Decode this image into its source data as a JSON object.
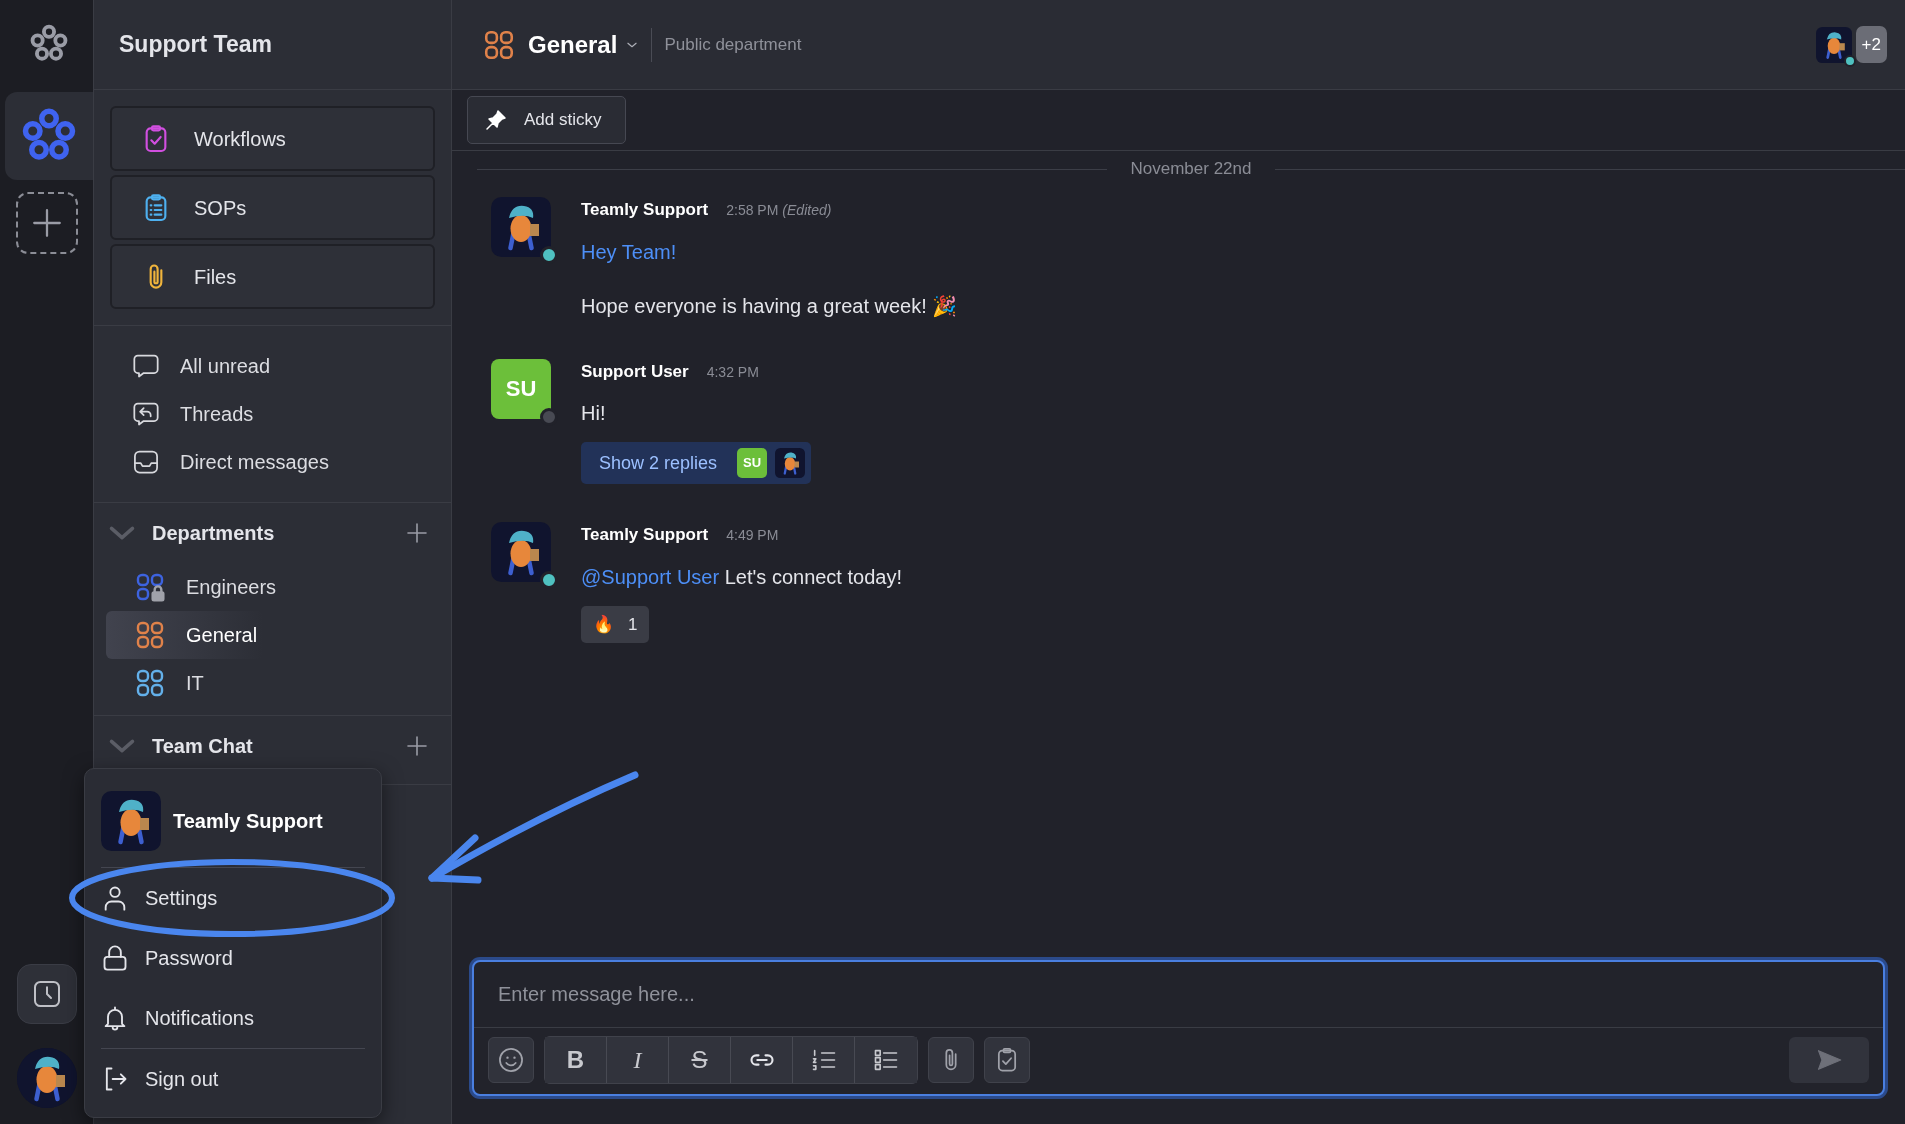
{
  "rail": {
    "workspaces": [
      {
        "selected": false
      },
      {
        "selected": true
      }
    ]
  },
  "sidebar": {
    "title": "Support Team",
    "tools": [
      {
        "label": "Workflows",
        "kind": "workflows"
      },
      {
        "label": "SOPs",
        "kind": "sops"
      },
      {
        "label": "Files",
        "kind": "files"
      }
    ],
    "views": [
      {
        "label": "All unread",
        "kind": "unread"
      },
      {
        "label": "Threads",
        "kind": "threads"
      },
      {
        "label": "Direct messages",
        "kind": "direct"
      }
    ],
    "sections": [
      {
        "title": "Departments",
        "expanded": true,
        "items": [
          {
            "label": "Engineers",
            "color": "#3d63e0",
            "locked": true,
            "selected": false
          },
          {
            "label": "General",
            "color": "#e0824a",
            "locked": false,
            "selected": true
          },
          {
            "label": "IT",
            "color": "#63b0ea",
            "locked": false,
            "selected": false
          }
        ]
      },
      {
        "title": "Team Chat",
        "expanded": true
      }
    ]
  },
  "channel_header": {
    "name": "General",
    "color": "#e0824a",
    "description": "Public department",
    "online": true,
    "extra_members": "+2"
  },
  "toolbar": {
    "add_sticky": "Add sticky"
  },
  "date_divider": "November 22nd",
  "messages": [
    {
      "author": "Teamly Support",
      "kind": "mascot",
      "online": true,
      "time": "2:58 PM",
      "edited": "(Edited)",
      "paragraphs": [
        {
          "spans": [
            {
              "kind": "link",
              "text": "Hey Team!"
            }
          ]
        },
        {
          "spans": [
            {
              "kind": "plain",
              "text": "Hope everyone is having a great week! 🎉"
            }
          ]
        }
      ]
    },
    {
      "author": "Support User",
      "kind": "initials",
      "initials": "SU",
      "online": false,
      "time": "4:32 PM",
      "paragraphs": [
        {
          "spans": [
            {
              "kind": "plain",
              "text": "Hi!"
            }
          ]
        }
      ],
      "replies": {
        "label": "Show 2 replies",
        "avatars": [
          {
            "kind": "initials",
            "initials": "SU"
          },
          {
            "kind": "mascot"
          }
        ]
      }
    },
    {
      "author": "Teamly Support",
      "kind": "mascot",
      "online": true,
      "time": "4:49 PM",
      "paragraphs": [
        {
          "spans": [
            {
              "kind": "mention",
              "text": "@Support User"
            },
            {
              "kind": "plain",
              "text": "Let's connect today!"
            }
          ]
        }
      ],
      "reactions": [
        {
          "emoji": "🔥",
          "count": "1"
        }
      ]
    }
  ],
  "composer": {
    "placeholder": "Enter message here...",
    "format_buttons": [
      {
        "kind": "bold",
        "glyph": "B"
      },
      {
        "kind": "italic",
        "glyph": "I"
      },
      {
        "kind": "strike",
        "glyph": "S"
      },
      {
        "kind": "link"
      },
      {
        "kind": "ordered"
      },
      {
        "kind": "bullets"
      }
    ]
  },
  "user_menu": {
    "name": "Teamly Support",
    "items": [
      {
        "label": "Settings",
        "kind": "user",
        "circled": true,
        "divider_before": false
      },
      {
        "label": "Password",
        "kind": "lock",
        "circled": false,
        "divider_before": false
      },
      {
        "label": "Notifications",
        "kind": "bell",
        "circled": false,
        "divider_before": false
      },
      {
        "label": "Sign out",
        "kind": "signout",
        "circled": false,
        "divider_before": true
      }
    ]
  }
}
